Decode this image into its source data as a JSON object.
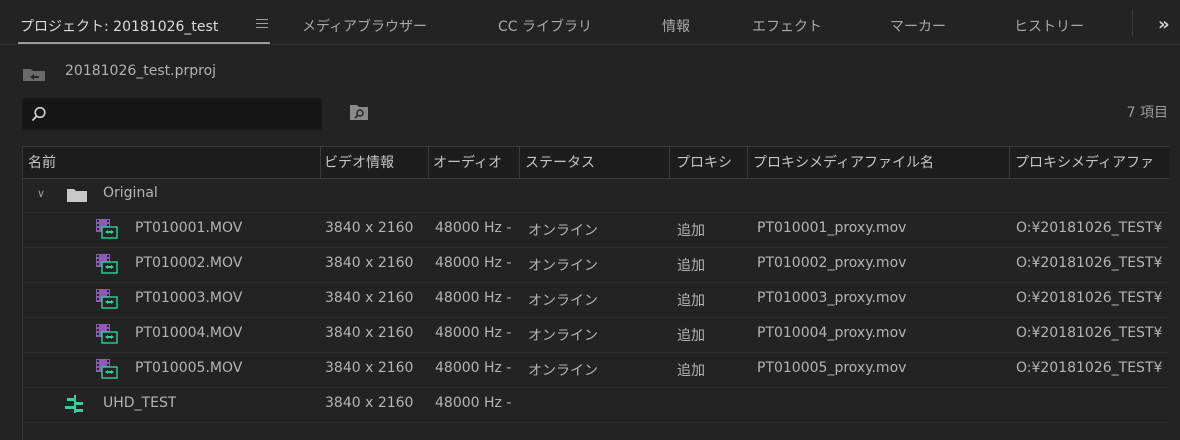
{
  "tabs": [
    {
      "label": "プロジェクト: 20181026_test",
      "active": true
    },
    {
      "label": "メディアブラウザー"
    },
    {
      "label": "CC ライブラリ"
    },
    {
      "label": "情報"
    },
    {
      "label": "エフェクト"
    },
    {
      "label": "マーカー"
    },
    {
      "label": "ヒストリー"
    }
  ],
  "more_tabs_glyph": "»",
  "project": {
    "filename": "20181026_test.prproj"
  },
  "search": {
    "value": "",
    "placeholder": ""
  },
  "item_count": "7 項目",
  "columns": [
    "名前",
    "ビデオ情報",
    "オーディオ",
    "ステータス",
    "プロキシ",
    "プロキシメディアファイル名",
    "プロキシメディアファ"
  ],
  "rows": [
    {
      "type": "bin",
      "expand_glyph": "∨",
      "name": "Original",
      "video": "",
      "audio": "",
      "status": "",
      "proxy": "",
      "proxy_file": "",
      "proxy_path": ""
    },
    {
      "type": "clip",
      "name": "PT010001.MOV",
      "video": "3840 x 2160",
      "audio": "48000 Hz -",
      "status": "オンライン",
      "proxy": "追加",
      "proxy_file": "PT010001_proxy.mov",
      "proxy_path": "O:¥20181026_TEST¥"
    },
    {
      "type": "clip",
      "name": "PT010002.MOV",
      "video": "3840 x 2160",
      "audio": "48000 Hz -",
      "status": "オンライン",
      "proxy": "追加",
      "proxy_file": "PT010002_proxy.mov",
      "proxy_path": "O:¥20181026_TEST¥"
    },
    {
      "type": "clip",
      "name": "PT010003.MOV",
      "video": "3840 x 2160",
      "audio": "48000 Hz -",
      "status": "オンライン",
      "proxy": "追加",
      "proxy_file": "PT010003_proxy.mov",
      "proxy_path": "O:¥20181026_TEST¥"
    },
    {
      "type": "clip",
      "name": "PT010004.MOV",
      "video": "3840 x 2160",
      "audio": "48000 Hz -",
      "status": "オンライン",
      "proxy": "追加",
      "proxy_file": "PT010004_proxy.mov",
      "proxy_path": "O:¥20181026_TEST¥"
    },
    {
      "type": "clip",
      "name": "PT010005.MOV",
      "video": "3840 x 2160",
      "audio": "48000 Hz -",
      "status": "オンライン",
      "proxy": "追加",
      "proxy_file": "PT010005_proxy.mov",
      "proxy_path": "O:¥20181026_TEST¥"
    },
    {
      "type": "sequence",
      "name": "UHD_TEST",
      "video": "3840 x 2160",
      "audio": "48000 Hz -",
      "status": "",
      "proxy": "",
      "proxy_file": "",
      "proxy_path": ""
    }
  ],
  "colors": {
    "background": "#232323",
    "clip_icon": "#8c5bb5",
    "clip_icon_accent": "#2fd19a",
    "sequence_icon": "#3ec9a0"
  }
}
